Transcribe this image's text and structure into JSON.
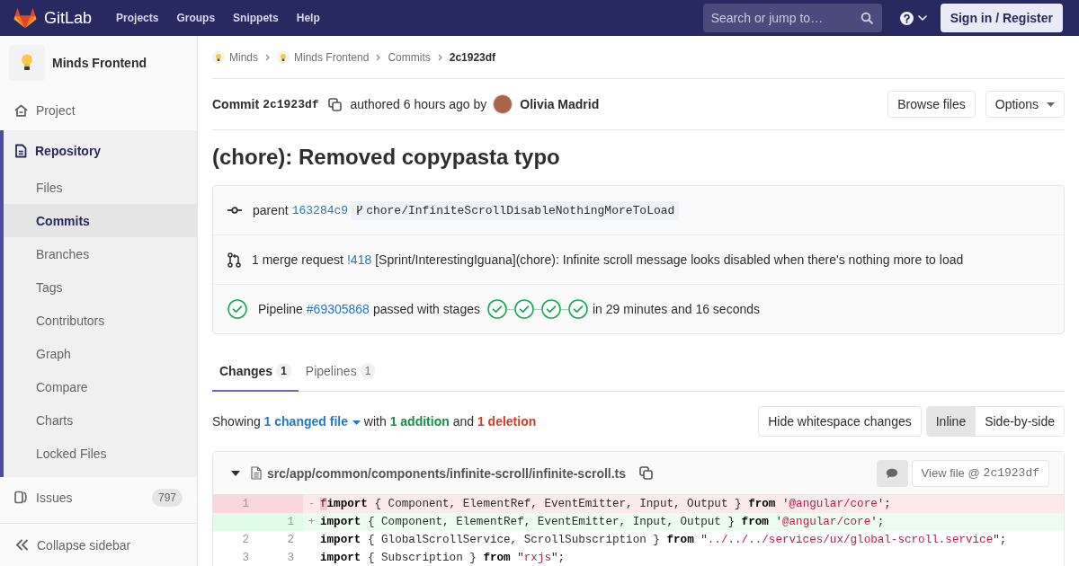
{
  "top_nav": {
    "logo_text": "GitLab",
    "links": [
      "Projects",
      "Groups",
      "Snippets",
      "Help"
    ],
    "search": {
      "placeholder": "Search or jump to…"
    },
    "sign_in": "Sign in / Register"
  },
  "sidebar": {
    "project_name": "Minds Frontend",
    "items": [
      {
        "label": "Project",
        "selected": false
      },
      {
        "label": "Repository",
        "selected": true,
        "children": [
          {
            "label": "Files",
            "selected": false
          },
          {
            "label": "Commits",
            "selected": true
          },
          {
            "label": "Branches",
            "selected": false
          },
          {
            "label": "Tags",
            "selected": false
          },
          {
            "label": "Contributors",
            "selected": false
          },
          {
            "label": "Graph",
            "selected": false
          },
          {
            "label": "Compare",
            "selected": false
          },
          {
            "label": "Charts",
            "selected": false
          },
          {
            "label": "Locked Files",
            "selected": false
          }
        ]
      },
      {
        "label": "Issues",
        "count": "797",
        "selected": false
      }
    ],
    "collapse_label": "Collapse sidebar"
  },
  "breadcrumbs": [
    {
      "label": "Minds",
      "kind": "avatar"
    },
    {
      "label": "Minds Frontend",
      "kind": "avatar"
    },
    {
      "label": "Commits",
      "kind": "plain"
    },
    {
      "label": "2c1923df",
      "kind": "current"
    }
  ],
  "commit": {
    "label": "Commit",
    "hash": "2c1923df",
    "authored": "authored 6 hours ago by",
    "author": "Olivia Madrid",
    "browse_button": "Browse files",
    "options_button": "Options",
    "title": "(chore): Removed copypasta typo"
  },
  "info_panel": {
    "parent": {
      "label": "parent",
      "hash": "163284c9",
      "branch": "chore/InfiniteScrollDisableNothingMoreToLoad"
    },
    "merge_requests": {
      "count_label": "1 merge request",
      "link": "!418",
      "title": "[Sprint/InterestingIguana](chore): Infinite scroll message looks disabled when there's nothing more to load"
    },
    "pipeline": {
      "label": "Pipeline",
      "id": "#69305868",
      "passed": true,
      "status_text": "passed with stages",
      "stages": [
        {
          "passed": true
        },
        {
          "passed": true
        },
        {
          "passed": true
        },
        {
          "passed": true
        }
      ],
      "duration": "in 29 minutes and 16 seconds"
    }
  },
  "tabs": [
    {
      "label": "Changes",
      "count": "1",
      "selected": true
    },
    {
      "label": "Pipelines",
      "count": "1",
      "selected": false
    }
  ],
  "diff_summary": {
    "showing": "Showing",
    "files": "1 changed file",
    "with": "with",
    "additions": "1 addition",
    "and": "and",
    "deletions": "1 deletion"
  },
  "diff_controls": {
    "whitespace": "Hide whitespace changes",
    "views": [
      {
        "label": "Inline",
        "selected": true
      },
      {
        "label": "Side-by-side",
        "selected": false
      }
    ]
  },
  "diff_file": {
    "expanded": true,
    "path": "src/app/common/components/infinite-scroll/infinite-scroll.ts",
    "view_file": {
      "label": "View file @",
      "hash": "2c1923df"
    },
    "lines": [
      {
        "kind": "deleted",
        "old": "1",
        "sign": "-",
        "segments": [
          {
            "kind": "changed",
            "text": "f"
          },
          {
            "kind": "keyword",
            "text": "import"
          },
          {
            "kind": "plain",
            "text": " { Component, ElementRef, EventEmitter, Input, Output } "
          },
          {
            "kind": "keyword",
            "text": "from"
          },
          {
            "kind": "plain",
            "text": " '"
          },
          {
            "kind": "string",
            "text": "@angular/core"
          },
          {
            "kind": "plain",
            "text": "';"
          }
        ]
      },
      {
        "kind": "added",
        "new": "1",
        "sign": "+",
        "segments": [
          {
            "kind": "keyword",
            "text": "import"
          },
          {
            "kind": "plain",
            "text": " { Component, ElementRef, EventEmitter, Input, Output } "
          },
          {
            "kind": "keyword",
            "text": "from"
          },
          {
            "kind": "plain",
            "text": " '"
          },
          {
            "kind": "string",
            "text": "@angular/core"
          },
          {
            "kind": "plain",
            "text": "';"
          }
        ]
      },
      {
        "kind": "context",
        "old": "2",
        "new": "2",
        "segments": [
          {
            "kind": "keyword",
            "text": "import"
          },
          {
            "kind": "plain",
            "text": " { GlobalScrollService, ScrollSubscription } "
          },
          {
            "kind": "keyword",
            "text": "from"
          },
          {
            "kind": "plain",
            "text": " \""
          },
          {
            "kind": "string",
            "text": "../../../services/ux/global-scroll.service"
          },
          {
            "kind": "plain",
            "text": "\";"
          }
        ]
      },
      {
        "kind": "context",
        "old": "3",
        "new": "3",
        "segments": [
          {
            "kind": "keyword",
            "text": "import"
          },
          {
            "kind": "plain",
            "text": " { Subscription } "
          },
          {
            "kind": "keyword",
            "text": "from"
          },
          {
            "kind": "plain",
            "text": " \""
          },
          {
            "kind": "string",
            "text": "rxjs"
          },
          {
            "kind": "plain",
            "text": "\";"
          }
        ]
      }
    ]
  }
}
